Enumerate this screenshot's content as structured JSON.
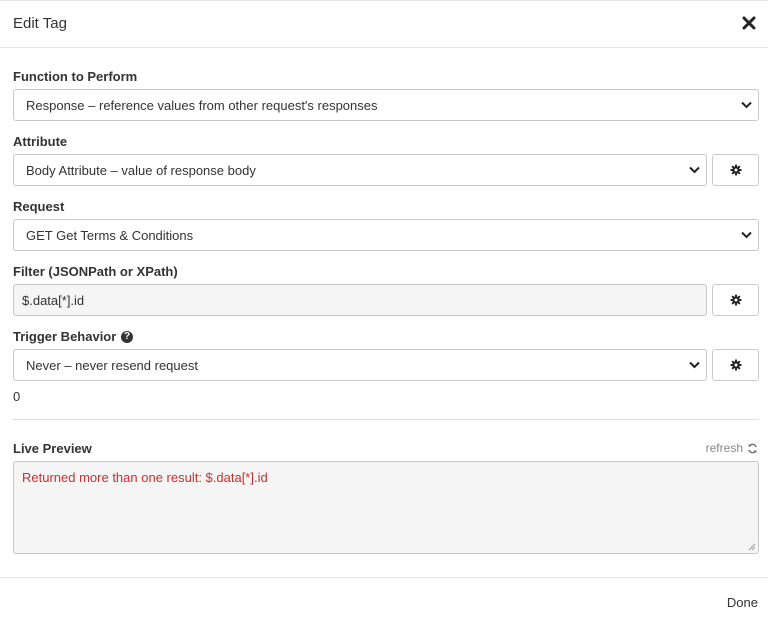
{
  "dialog": {
    "title": "Edit Tag"
  },
  "function": {
    "label": "Function to Perform",
    "selected": "Response – reference values from other request's responses"
  },
  "attribute": {
    "label": "Attribute",
    "selected": "Body Attribute – value of response body"
  },
  "request": {
    "label": "Request",
    "selected": "GET Get Terms & Conditions"
  },
  "filter": {
    "label": "Filter (JSONPath or XPath)",
    "value": "$.data[*].id"
  },
  "trigger": {
    "label": "Trigger Behavior",
    "selected": "Never – never resend request",
    "value_text": "0"
  },
  "preview": {
    "label": "Live Preview",
    "refresh_label": "refresh",
    "result": "Returned more than one result: $.data[*].id"
  },
  "footer": {
    "done_label": "Done"
  },
  "icons": {
    "close": "close-icon",
    "settings": "gear-icon",
    "help": "question-circle-icon",
    "refresh": "refresh-icon",
    "dropdown": "chevron-down-icon"
  },
  "colors": {
    "error_text": "#c9302c",
    "muted": "#888888"
  }
}
